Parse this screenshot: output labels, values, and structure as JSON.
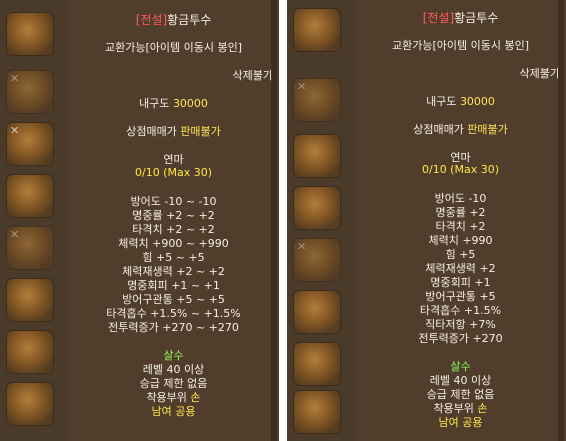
{
  "left": {
    "grade": "[전설]",
    "name": "황금투수",
    "trade": "교환가능[아이템 이동시 봉인]",
    "delete": "삭제불가",
    "durability_label": "내구도",
    "durability_value": "30000",
    "shop_label": "상점매매가",
    "shop_value": "판매불가",
    "refine_label": "연마",
    "refine_value": "0/10 (Max 30)",
    "stats": [
      {
        "label": "방어도",
        "value": "-10 ~ -10"
      },
      {
        "label": "명중률",
        "value": "+2 ~ +2"
      },
      {
        "label": "타격치",
        "value": "+2 ~ +2"
      },
      {
        "label": "체력치",
        "value": "+900 ~ +990"
      },
      {
        "label": "힘",
        "value": "+5 ~ +5"
      },
      {
        "label": "체력재생력",
        "value": "+2 ~ +2"
      },
      {
        "label": "명중회피",
        "value": "+1 ~ +1"
      },
      {
        "label": "방어구관통",
        "value": "+5 ~ +5"
      },
      {
        "label": "타격흡수",
        "value": "+1.5% ~ +1.5%"
      },
      {
        "label": "전투력증가",
        "value": "+270 ~ +270"
      }
    ],
    "job": "살수",
    "level": "레벨 40 이상",
    "grade_limit": "승급 제한 없음",
    "slot_label": "착용부위",
    "slot_value": "손",
    "gender": "남여 공용"
  },
  "right": {
    "grade": "[전설]",
    "name": "황금투수",
    "trade": "교환가능[아이템 이동시 봉인]",
    "delete": "삭제불가",
    "durability_label": "내구도",
    "durability_value": "30000",
    "shop_label": "상점매매가",
    "shop_value": "판매불가",
    "refine_label": "연마",
    "refine_value": "0/10 (Max 30)",
    "stats": [
      {
        "label": "방어도",
        "value": "-10"
      },
      {
        "label": "명중률",
        "value": "+2"
      },
      {
        "label": "타격치",
        "value": "+2"
      },
      {
        "label": "체력치",
        "value": "+990"
      },
      {
        "label": "힘",
        "value": "+5"
      },
      {
        "label": "체력재생력",
        "value": "+2"
      },
      {
        "label": "명중회피",
        "value": "+1"
      },
      {
        "label": "방어구관통",
        "value": "+5"
      },
      {
        "label": "타격흡수",
        "value": "+1.5%"
      },
      {
        "label": "직타저항",
        "value": "+7%"
      },
      {
        "label": "전투력증가",
        "value": "+270"
      }
    ],
    "job": "살수",
    "level": "레벨 40 이상",
    "grade_limit": "승급 제한 없음",
    "slot_label": "착용부위",
    "slot_value": "손",
    "gender": "남여 공용"
  }
}
